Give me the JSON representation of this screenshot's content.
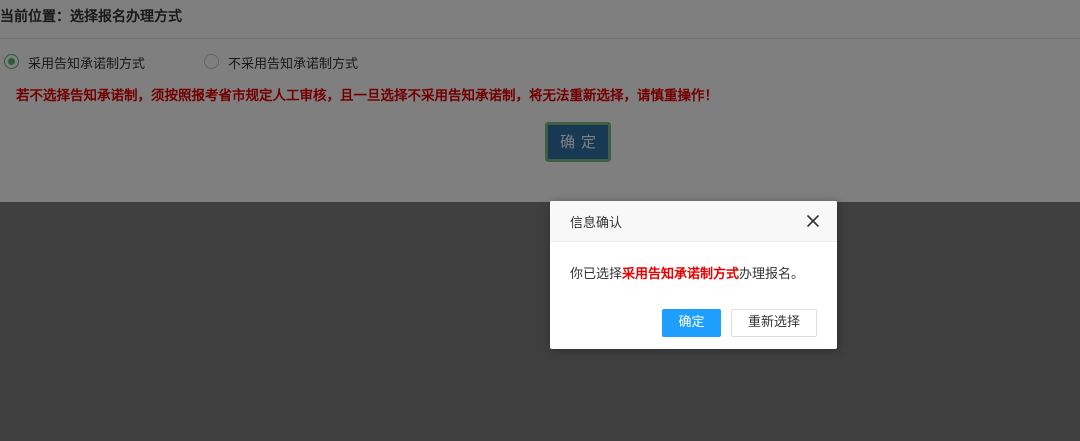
{
  "breadcrumb": {
    "text": "当前位置：选择报名办理方式"
  },
  "options": [
    {
      "label": "采用告知承诺制方式",
      "checked": true
    },
    {
      "label": "不采用告知承诺制方式",
      "checked": false
    }
  ],
  "warning": "若不选择告知承诺制，须按照报考省市规定人工审核，且一旦选择不采用告知承诺制，将无法重新选择，请慎重操作！",
  "main_confirm_label": "确定",
  "dialog": {
    "title": "信息确认",
    "message_prefix": "你已选择",
    "message_highlight": "采用告知承诺制方式",
    "message_suffix": "办理报名。",
    "confirm_label": "确定",
    "reselect_label": "重新选择"
  },
  "colors": {
    "warning": "#e60000",
    "radio_checked": "#5fb878",
    "main_button": "#2e73a8",
    "dialog_primary": "#1e9fff"
  }
}
